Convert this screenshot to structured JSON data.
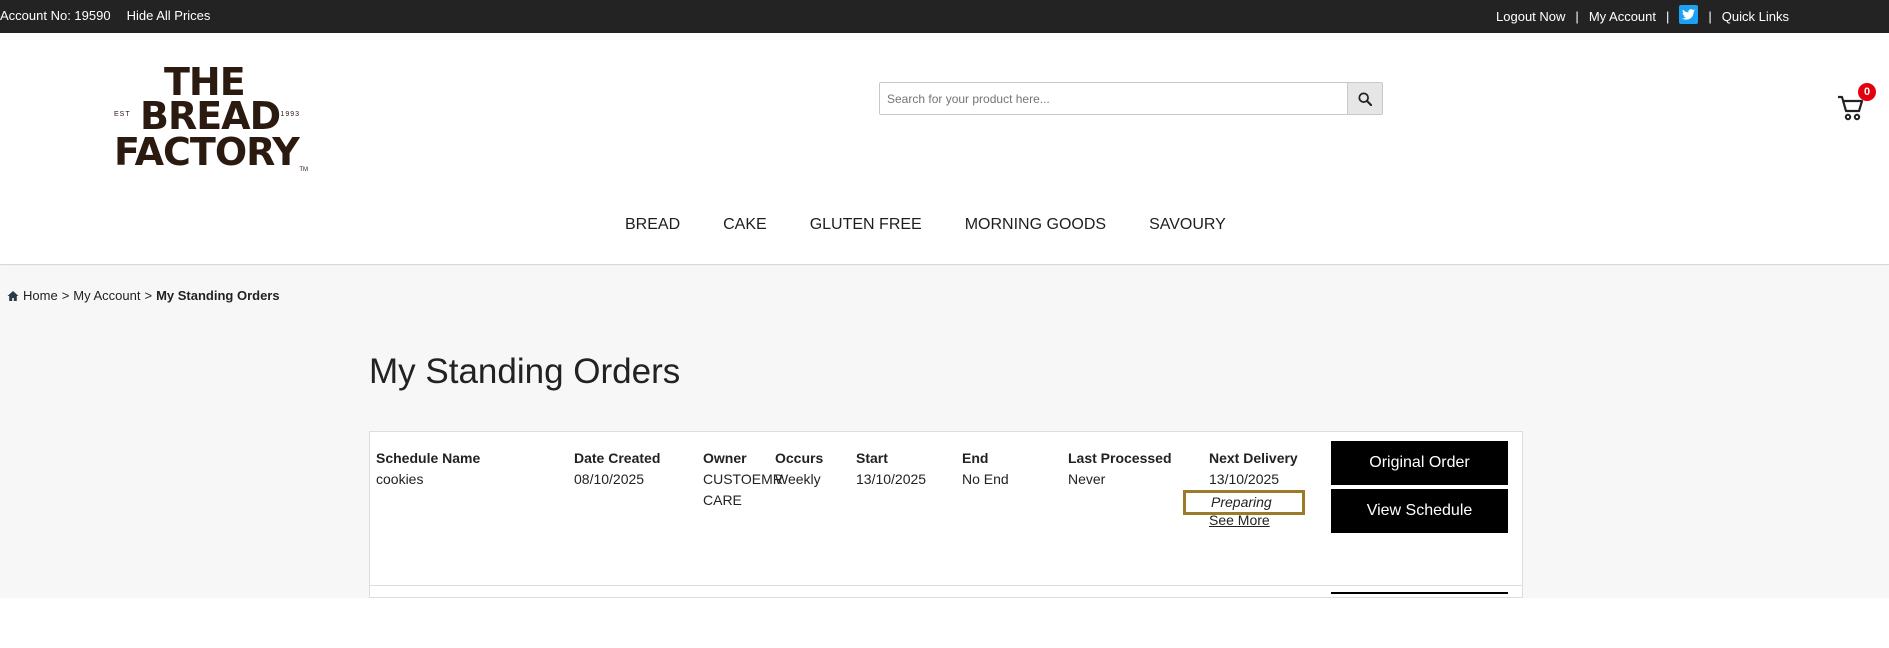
{
  "topbar": {
    "account_no": "Account No: 19590",
    "hide_prices": "Hide All Prices",
    "logout": "Logout Now",
    "my_account": "My Account",
    "quick_links": "Quick Links",
    "sep": "|"
  },
  "logo": {
    "line1": "THE",
    "line2": "BREAD",
    "line3": "FACTORY",
    "est": "EST",
    "year": "1993",
    "tm": "TM"
  },
  "search": {
    "placeholder": "Search for your product here..."
  },
  "cart": {
    "count": "0"
  },
  "nav": [
    "BREAD",
    "CAKE",
    "GLUTEN FREE",
    "MORNING GOODS",
    "SAVOURY"
  ],
  "breadcrumb": {
    "home": "Home",
    "sep": ">",
    "my_account": "My Account",
    "current": "My Standing Orders"
  },
  "page_title": "My Standing Orders",
  "table": {
    "headers": [
      "Schedule Name",
      "Date Created",
      "Owner",
      "Occurs",
      "Start",
      "End",
      "Last Processed",
      "Next Delivery"
    ],
    "rows": [
      {
        "schedule_name": "cookies",
        "date_created": "08/10/2025",
        "owner_line1": "CUSTOEMR",
        "owner_line2": "CARE",
        "occurs": "Weekly",
        "start": "13/10/2025",
        "end": "No End",
        "last_processed": "Never",
        "next_delivery": "13/10/2025",
        "status": "Preparing",
        "see_more": "See More",
        "original_order": "Original Order",
        "view_schedule": "View Schedule"
      }
    ]
  },
  "colors": {
    "topbar_bg": "#232323",
    "status_border": "#9b7a28",
    "cart_badge": "#e3000f",
    "twitter": "#1da1f2"
  }
}
